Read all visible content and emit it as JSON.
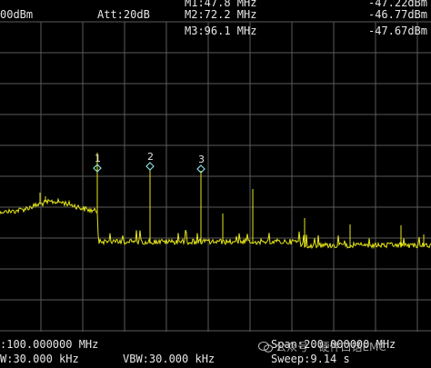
{
  "header": {
    "ref_level": "00dBm",
    "attenuation": "Att:20dB",
    "markers": [
      {
        "id": "1",
        "label": "M1:47.8 MHz",
        "amplitude": "-47.22dBm",
        "freq_mhz": 47.8,
        "level_dbm": -47.22
      },
      {
        "id": "2",
        "label": "M2:72.2 MHz",
        "amplitude": "-46.77dBm",
        "freq_mhz": 72.2,
        "level_dbm": -46.77
      },
      {
        "id": "3",
        "label": "M3:96.1 MHz",
        "amplitude": "-47.67dBm",
        "freq_mhz": 96.1,
        "level_dbm": -47.67
      }
    ]
  },
  "footer": {
    "center": ":100.000000 MHz",
    "span": "Span:200.000000 MHz",
    "rbw": "W:30.000 kHz",
    "vbw": "VBW:30.000 kHz",
    "sweep": "Sweep:9.14 s"
  },
  "watermark": "公众号 · 硬件口话EMC",
  "colors": {
    "trace": "#e6e619",
    "grid": "#5a5a5a",
    "marker": "#88dcd8",
    "background": "#000000"
  }
}
